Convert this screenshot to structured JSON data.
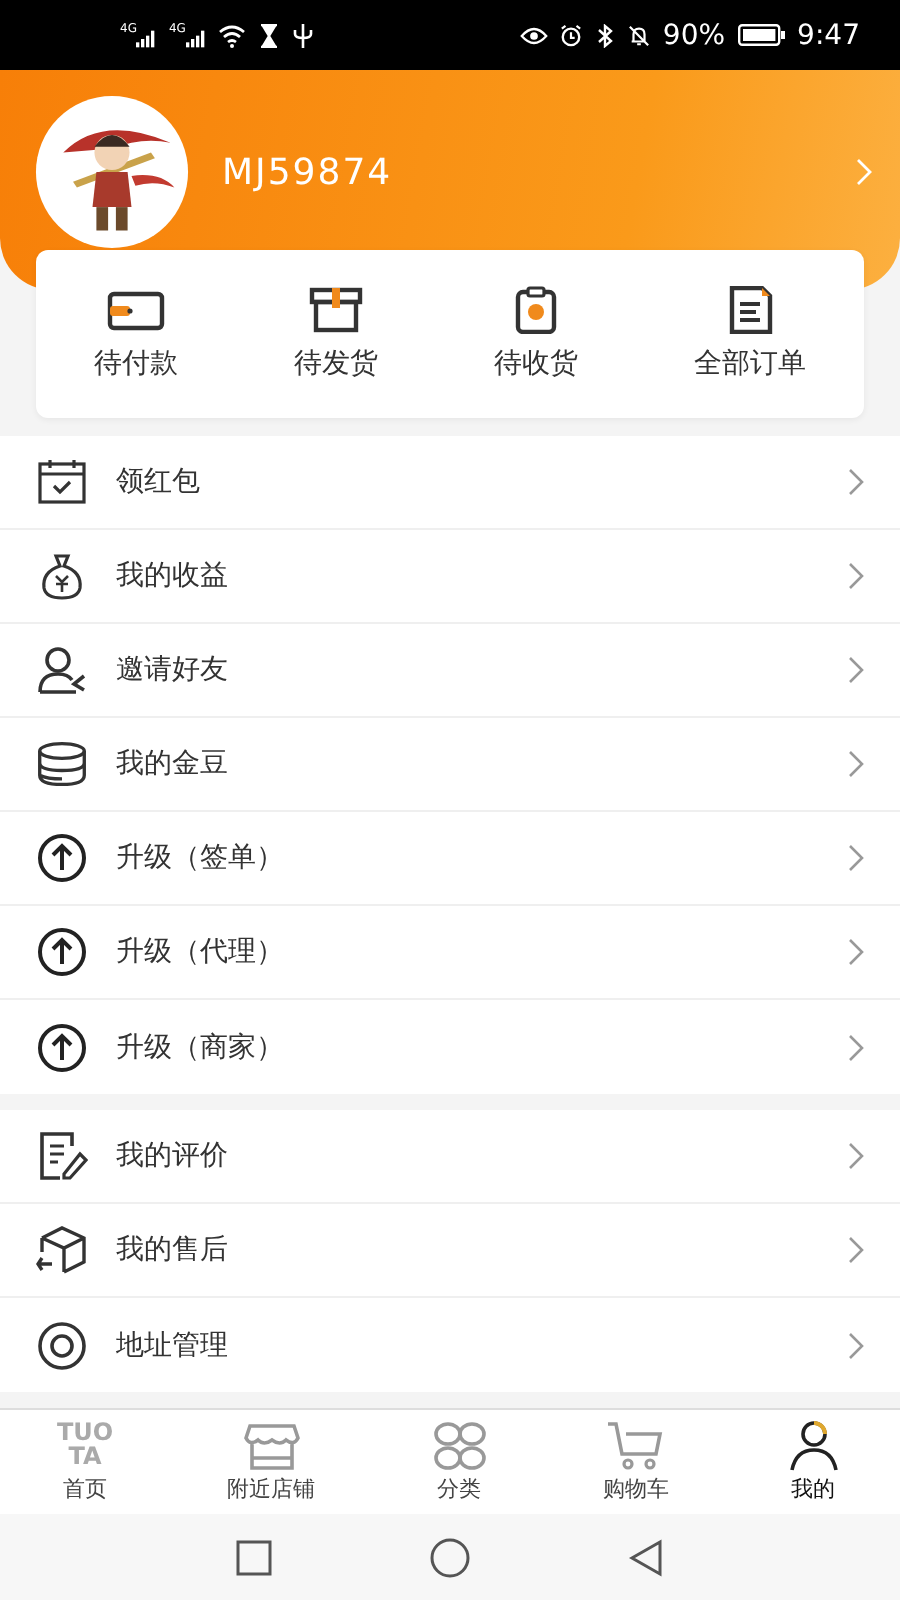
{
  "status_bar": {
    "networks": [
      "4G",
      "4G"
    ],
    "battery": "90%",
    "time": "9:47"
  },
  "profile": {
    "username": "MJ59874"
  },
  "orders": [
    {
      "label": "待付款"
    },
    {
      "label": "待发货"
    },
    {
      "label": "待收货"
    },
    {
      "label": "全部订单"
    }
  ],
  "menu_sections": [
    {
      "items": [
        {
          "label": "领红包"
        },
        {
          "label": "我的收益"
        },
        {
          "label": "邀请好友"
        },
        {
          "label": "我的金豆"
        },
        {
          "label": "升级（签单）"
        },
        {
          "label": "升级（代理）"
        },
        {
          "label": "升级（商家）"
        }
      ]
    },
    {
      "items": [
        {
          "label": "我的评价"
        },
        {
          "label": "我的售后"
        },
        {
          "label": "地址管理"
        }
      ]
    }
  ],
  "tab_bar": [
    {
      "label": "首页",
      "logo": [
        "TUO",
        "TA"
      ],
      "selected": false
    },
    {
      "label": "附近店铺",
      "selected": false
    },
    {
      "label": "分类",
      "selected": false
    },
    {
      "label": "购物车",
      "selected": false
    },
    {
      "label": "我的",
      "selected": true
    }
  ]
}
